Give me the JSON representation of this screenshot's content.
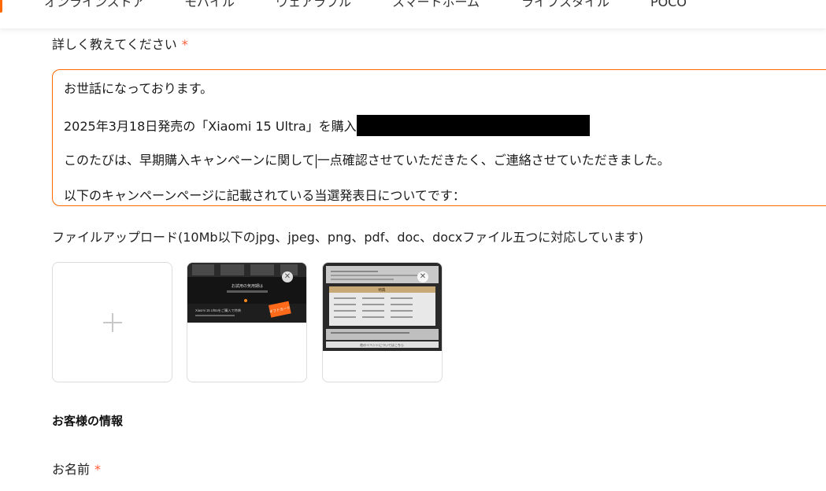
{
  "nav": {
    "items": [
      {
        "label": "オンラインストア"
      },
      {
        "label": "モバイル"
      },
      {
        "label": "ウェアラブル"
      },
      {
        "label": "スマートホーム"
      },
      {
        "label": "ライフスタイル"
      },
      {
        "label": "POCO"
      }
    ]
  },
  "details": {
    "label": "詳しく教えてください",
    "required_mark": "*",
    "text_lines": [
      "お世話になっております。",
      "2025年3月18日発売の「Xiaomi 15 Ultra」を購入",
      "このたびは、早期購入キャンペーンに関して",
      "一点確認させていただきたく、ご連絡させていただきました。",
      "以下のキャンペーンページに記載されている当選発表日についてです："
    ]
  },
  "upload": {
    "label": "ファイルアップロード(10Mb以下のjpg、jpeg、png、pdf、doc、docxファイル五つに対応しています)",
    "add_icon": "plus-icon",
    "thumbnails": [
      {
        "name": "uploaded-image-1",
        "remove_icon": "close-icon",
        "mini_text": [
          "お試用の気用期は",
          "Xiaomi 15 Ultraをご購入で特典",
          "ギフトカード"
        ]
      },
      {
        "name": "uploaded-image-2",
        "remove_icon": "close-icon",
        "mini_text": [
          "特典",
          "他のイベントについてはこちら"
        ]
      }
    ]
  },
  "customer": {
    "section_title": "お客様の情報",
    "name_label": "お名前",
    "name_required_mark": "*"
  },
  "colors": {
    "accent": "#ff6900",
    "required": "#ff5a36",
    "redaction": "#000000"
  }
}
